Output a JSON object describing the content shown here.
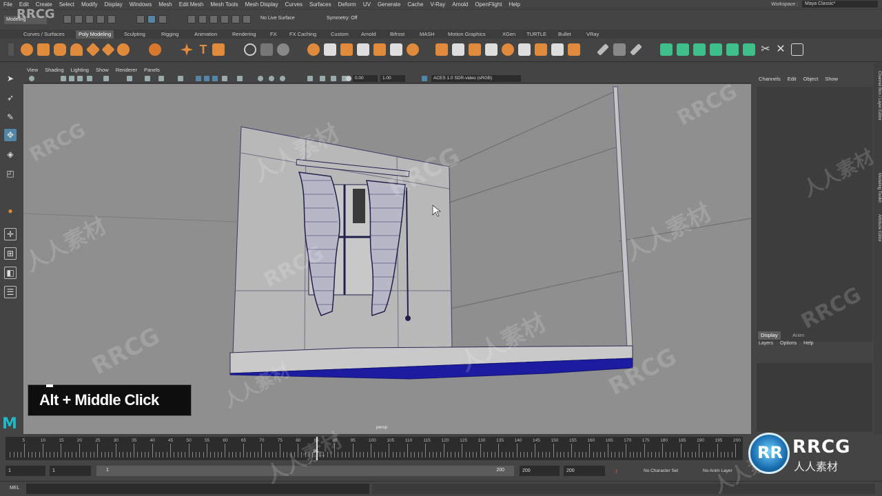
{
  "menu": {
    "items": [
      "File",
      "Edit",
      "Create",
      "Select",
      "Modify",
      "Display",
      "Windows",
      "Mesh",
      "Edit Mesh",
      "Mesh Tools",
      "Mesh Display",
      "Curves",
      "Surfaces",
      "Deform",
      "UV",
      "Generate",
      "Cache",
      "V-Ray",
      "Arnold",
      "OpenFlight",
      "Help"
    ],
    "workspace_label": "Workspace :",
    "workspace_value": "Maya Classic*"
  },
  "status": {
    "mode": "Modeling",
    "live_surface": "No Live Surface",
    "symmetry": "Symmetry: Off"
  },
  "shelf": {
    "tabs": [
      "Curves / Surfaces",
      "Poly Modeling",
      "Sculpting",
      "Rigging",
      "Animation",
      "Rendering",
      "FX",
      "FX Caching",
      "Custom",
      "Arnold",
      "Bifrost",
      "MASH",
      "Motion Graphics",
      "XGen",
      "TURTLE",
      "Bullet",
      "VRay"
    ],
    "active_tab": "Poly Modeling"
  },
  "viewport": {
    "menu": [
      "View",
      "Shading",
      "Lighting",
      "Show",
      "Renderer",
      "Panels"
    ],
    "exposure": "0.00",
    "gamma": "1.00",
    "colorspace": "ACES 1.0 SDR-video (sRGB)",
    "camera": "persp"
  },
  "caption": "Alt + Middle Click",
  "channel_box": {
    "menu": [
      "Channels",
      "Edit",
      "Object",
      "Show"
    ]
  },
  "layer_editor": {
    "tabs": [
      "Display",
      "Anim"
    ],
    "menu": [
      "Layers",
      "Options",
      "Help"
    ]
  },
  "side_tabs": [
    "Channel Box / Layer Editor",
    "Modeling Toolkit",
    "Attribute Editor"
  ],
  "timeline": {
    "ticks": [
      "5",
      "10",
      "15",
      "20",
      "25",
      "30",
      "35",
      "40",
      "45",
      "50",
      "55",
      "60",
      "65",
      "70",
      "75",
      "80",
      "85",
      "90",
      "95",
      "100",
      "105",
      "110",
      "115",
      "120",
      "125",
      "130",
      "135",
      "140",
      "145",
      "150",
      "155",
      "160",
      "165",
      "170",
      "175",
      "180",
      "185",
      "190",
      "195",
      "200"
    ],
    "current_frame": "85"
  },
  "range": {
    "start": "1",
    "playback_start": "1",
    "bar_start": "1",
    "bar_end": "200",
    "playback_end": "200",
    "end": "200",
    "character_set": "No Character Set",
    "anim_layer": "No Anim Layer"
  },
  "command": {
    "label": "MEL"
  },
  "watermark": {
    "corner_brand": "RRCG",
    "corner_sub": "人人素材",
    "top_left": "RRCG",
    "badge": "RR",
    "repeat_a": "RRCG",
    "repeat_b": "人人素材"
  }
}
